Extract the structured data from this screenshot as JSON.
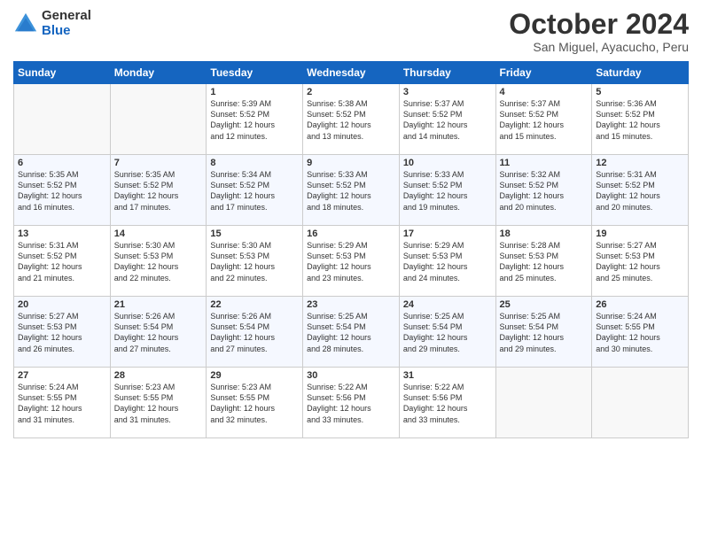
{
  "logo": {
    "general": "General",
    "blue": "Blue"
  },
  "title": "October 2024",
  "location": "San Miguel, Ayacucho, Peru",
  "days_of_week": [
    "Sunday",
    "Monday",
    "Tuesday",
    "Wednesday",
    "Thursday",
    "Friday",
    "Saturday"
  ],
  "weeks": [
    [
      {
        "num": "",
        "info": "",
        "empty": true
      },
      {
        "num": "",
        "info": "",
        "empty": true
      },
      {
        "num": "1",
        "info": "Sunrise: 5:39 AM\nSunset: 5:52 PM\nDaylight: 12 hours\nand 12 minutes."
      },
      {
        "num": "2",
        "info": "Sunrise: 5:38 AM\nSunset: 5:52 PM\nDaylight: 12 hours\nand 13 minutes."
      },
      {
        "num": "3",
        "info": "Sunrise: 5:37 AM\nSunset: 5:52 PM\nDaylight: 12 hours\nand 14 minutes."
      },
      {
        "num": "4",
        "info": "Sunrise: 5:37 AM\nSunset: 5:52 PM\nDaylight: 12 hours\nand 15 minutes."
      },
      {
        "num": "5",
        "info": "Sunrise: 5:36 AM\nSunset: 5:52 PM\nDaylight: 12 hours\nand 15 minutes."
      }
    ],
    [
      {
        "num": "6",
        "info": "Sunrise: 5:35 AM\nSunset: 5:52 PM\nDaylight: 12 hours\nand 16 minutes."
      },
      {
        "num": "7",
        "info": "Sunrise: 5:35 AM\nSunset: 5:52 PM\nDaylight: 12 hours\nand 17 minutes."
      },
      {
        "num": "8",
        "info": "Sunrise: 5:34 AM\nSunset: 5:52 PM\nDaylight: 12 hours\nand 17 minutes."
      },
      {
        "num": "9",
        "info": "Sunrise: 5:33 AM\nSunset: 5:52 PM\nDaylight: 12 hours\nand 18 minutes."
      },
      {
        "num": "10",
        "info": "Sunrise: 5:33 AM\nSunset: 5:52 PM\nDaylight: 12 hours\nand 19 minutes."
      },
      {
        "num": "11",
        "info": "Sunrise: 5:32 AM\nSunset: 5:52 PM\nDaylight: 12 hours\nand 20 minutes."
      },
      {
        "num": "12",
        "info": "Sunrise: 5:31 AM\nSunset: 5:52 PM\nDaylight: 12 hours\nand 20 minutes."
      }
    ],
    [
      {
        "num": "13",
        "info": "Sunrise: 5:31 AM\nSunset: 5:52 PM\nDaylight: 12 hours\nand 21 minutes."
      },
      {
        "num": "14",
        "info": "Sunrise: 5:30 AM\nSunset: 5:53 PM\nDaylight: 12 hours\nand 22 minutes."
      },
      {
        "num": "15",
        "info": "Sunrise: 5:30 AM\nSunset: 5:53 PM\nDaylight: 12 hours\nand 22 minutes."
      },
      {
        "num": "16",
        "info": "Sunrise: 5:29 AM\nSunset: 5:53 PM\nDaylight: 12 hours\nand 23 minutes."
      },
      {
        "num": "17",
        "info": "Sunrise: 5:29 AM\nSunset: 5:53 PM\nDaylight: 12 hours\nand 24 minutes."
      },
      {
        "num": "18",
        "info": "Sunrise: 5:28 AM\nSunset: 5:53 PM\nDaylight: 12 hours\nand 25 minutes."
      },
      {
        "num": "19",
        "info": "Sunrise: 5:27 AM\nSunset: 5:53 PM\nDaylight: 12 hours\nand 25 minutes."
      }
    ],
    [
      {
        "num": "20",
        "info": "Sunrise: 5:27 AM\nSunset: 5:53 PM\nDaylight: 12 hours\nand 26 minutes."
      },
      {
        "num": "21",
        "info": "Sunrise: 5:26 AM\nSunset: 5:54 PM\nDaylight: 12 hours\nand 27 minutes."
      },
      {
        "num": "22",
        "info": "Sunrise: 5:26 AM\nSunset: 5:54 PM\nDaylight: 12 hours\nand 27 minutes."
      },
      {
        "num": "23",
        "info": "Sunrise: 5:25 AM\nSunset: 5:54 PM\nDaylight: 12 hours\nand 28 minutes."
      },
      {
        "num": "24",
        "info": "Sunrise: 5:25 AM\nSunset: 5:54 PM\nDaylight: 12 hours\nand 29 minutes."
      },
      {
        "num": "25",
        "info": "Sunrise: 5:25 AM\nSunset: 5:54 PM\nDaylight: 12 hours\nand 29 minutes."
      },
      {
        "num": "26",
        "info": "Sunrise: 5:24 AM\nSunset: 5:55 PM\nDaylight: 12 hours\nand 30 minutes."
      }
    ],
    [
      {
        "num": "27",
        "info": "Sunrise: 5:24 AM\nSunset: 5:55 PM\nDaylight: 12 hours\nand 31 minutes."
      },
      {
        "num": "28",
        "info": "Sunrise: 5:23 AM\nSunset: 5:55 PM\nDaylight: 12 hours\nand 31 minutes."
      },
      {
        "num": "29",
        "info": "Sunrise: 5:23 AM\nSunset: 5:55 PM\nDaylight: 12 hours\nand 32 minutes."
      },
      {
        "num": "30",
        "info": "Sunrise: 5:22 AM\nSunset: 5:56 PM\nDaylight: 12 hours\nand 33 minutes."
      },
      {
        "num": "31",
        "info": "Sunrise: 5:22 AM\nSunset: 5:56 PM\nDaylight: 12 hours\nand 33 minutes."
      },
      {
        "num": "",
        "info": "",
        "empty": true
      },
      {
        "num": "",
        "info": "",
        "empty": true
      }
    ]
  ]
}
